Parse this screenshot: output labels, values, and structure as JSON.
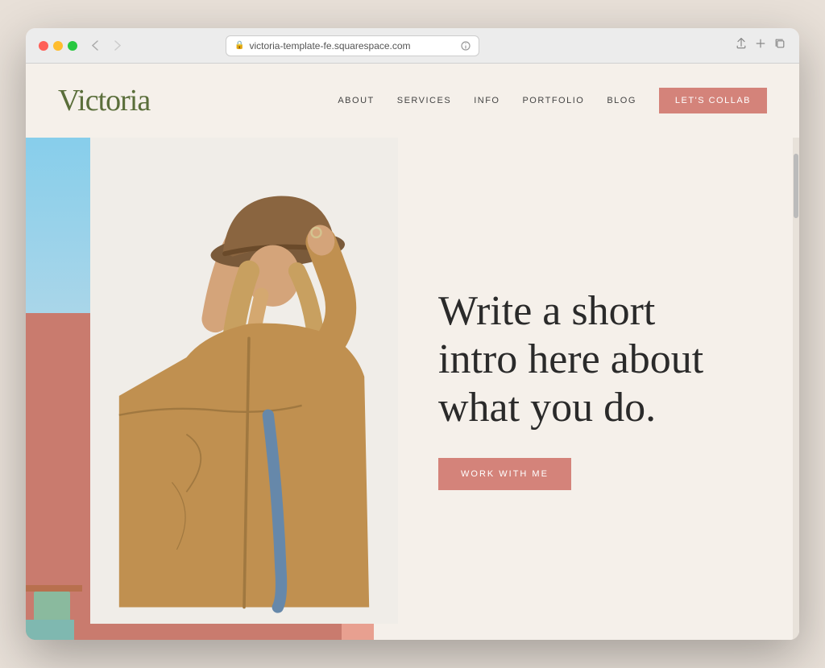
{
  "browser": {
    "url": "victoria-template-fe.squarespace.com",
    "nav": {
      "back": "‹",
      "forward": "›"
    }
  },
  "header": {
    "logo": "Victoria",
    "nav_items": [
      "ABOUT",
      "SERVICES",
      "INFO",
      "PORTFOLIO",
      "BLOG"
    ],
    "cta_label": "LET'S COLLAB"
  },
  "hero": {
    "heading_line1": "Write a short",
    "heading_line2": "intro here about",
    "heading_line3": "what you do.",
    "heading_full": "Write a short intro here about what you do.",
    "cta_label": "WORK WITH ME"
  },
  "colors": {
    "logo_green": "#5a6e3a",
    "cta_salmon": "#d4837a",
    "bg_cream": "#f5f0ea",
    "heading_dark": "#2a2a2a",
    "nav_text": "#444444"
  }
}
